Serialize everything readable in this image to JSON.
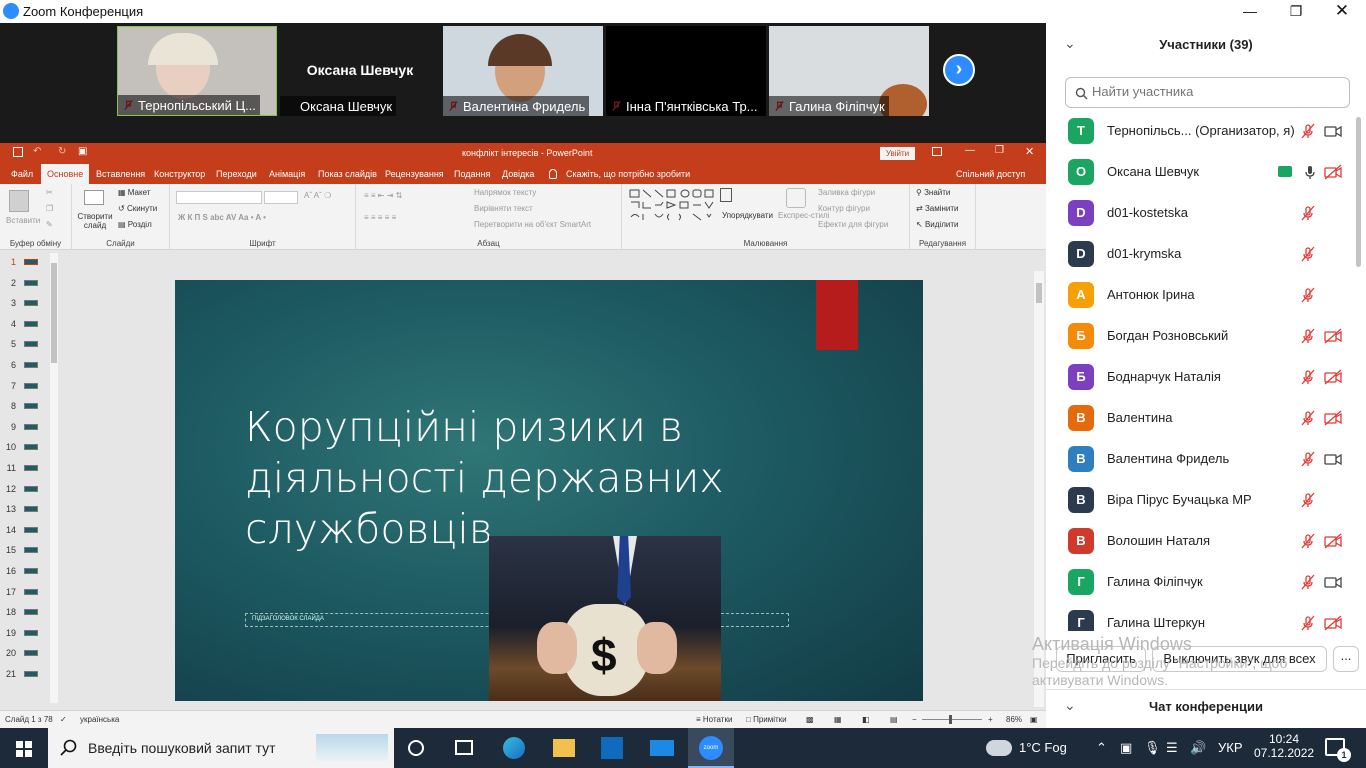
{
  "window": {
    "title": "Zoom Конференция"
  },
  "video_strip": {
    "tiles": [
      {
        "name": "Тернопільський Ц..."
      },
      {
        "name": "Оксана Шевчук",
        "center_name": "Оксана Шевчук"
      },
      {
        "name": "Валентина Фридель"
      },
      {
        "name": "Інна П'янтківська Тр..."
      },
      {
        "name": "Галина Філіпчук"
      }
    ]
  },
  "powerpoint": {
    "doc_title": "конфлікт інтересів - PowerPoint",
    "login_label": "Увійти",
    "share_label": "Спільний доступ",
    "tell_me": "Скажіть, що потрібно зробити",
    "tabs": [
      "Файл",
      "Основне",
      "Вставлення",
      "Конструктор",
      "Переходи",
      "Анімація",
      "Показ слайдів",
      "Рецензування",
      "Подання",
      "Довідка"
    ],
    "ribbon": {
      "paste": "Вставити",
      "clipboard": "Буфер обміну",
      "new_slide": "Створити слайд",
      "layout": "Макет",
      "reset": "Скинути",
      "section": "Розділ",
      "slides": "Слайди",
      "font": "Шрифт",
      "text_direction": "Напрямок тексту",
      "align_text": "Вирівняти текст",
      "smartart": "Перетворити на об'єкт SmartArt",
      "paragraph": "Абзац",
      "arrange": "Упорядкувати",
      "quick_styles": "Експрес-стилі",
      "fill": "Заливка фігури",
      "outline": "Контур фігури",
      "effects": "Ефекти для фігури",
      "drawing": "Малювання",
      "find": "Знайти",
      "replace": "Замінити",
      "select": "Виділити",
      "editing": "Редагування"
    },
    "thumbnails": [
      "1",
      "2",
      "3",
      "4",
      "5",
      "6",
      "7",
      "8",
      "9",
      "10",
      "11",
      "12",
      "13",
      "14",
      "15",
      "16",
      "17",
      "18",
      "19",
      "20",
      "21"
    ],
    "slide": {
      "title_line1": "Корупційні ризики в",
      "title_line2": "діяльності державних",
      "title_line3": "службовців",
      "subtitle_placeholder": "ПІДЗАГОЛОВОК СЛАЙДА"
    },
    "status": {
      "slide_counter": "Слайд 1 з 78",
      "language": "українська",
      "notes": "Нотатки",
      "comments": "Примітки",
      "zoom": "86%"
    }
  },
  "participants": {
    "header": "Участники (39)",
    "search_placeholder": "Найти участника",
    "list": [
      {
        "initial": "Т",
        "color": "#1ba563",
        "name": "Тернопільсь...  (Организатор, я)"
      },
      {
        "initial": "О",
        "color": "#1ba563",
        "name": "Оксана Шевчук"
      },
      {
        "initial": "D",
        "color": "#7b3fbf",
        "name": "d01-kostetska"
      },
      {
        "initial": "D",
        "color": "#2c3a4e",
        "name": "d01-krymska"
      },
      {
        "initial": "А",
        "color": "#f5a105",
        "name": "Антонюк Ірина"
      },
      {
        "initial": "Б",
        "color": "#f58a07",
        "name": "Богдан Розновський"
      },
      {
        "initial": "Б",
        "color": "#7b3fbf",
        "name": "Боднарчук Наталія"
      },
      {
        "initial": "В",
        "color": "#e56a0b",
        "name": "Валентина"
      },
      {
        "initial": "В",
        "color": "#2f7fc0",
        "name": "Валентина Фридель"
      },
      {
        "initial": "В",
        "color": "#2c3a4e",
        "name": "Віра Пірус Бучацька МР"
      },
      {
        "initial": "В",
        "color": "#cf3a2d",
        "name": "Волошин Наталя"
      },
      {
        "initial": "Г",
        "color": "#1ba563",
        "name": "Галина Філіпчук"
      },
      {
        "initial": "Г",
        "color": "#2c3a4e",
        "name": "Галина Штеркун"
      }
    ],
    "invite": "Пригласить",
    "mute_all": "Выключить звук для всех",
    "more": "...",
    "chat": "Чат конференции"
  },
  "watermark": {
    "line1": "Активація Windows",
    "line2": "Перейдіть до розділу \"Настройки\", щоб",
    "line3": "активувати Windows."
  },
  "taskbar": {
    "search": "Введіть пошуковий запит тут",
    "weather": "1°C  Fog",
    "lang": "УКР",
    "time": "10:24",
    "date": "07.12.2022",
    "notifications": "1"
  }
}
